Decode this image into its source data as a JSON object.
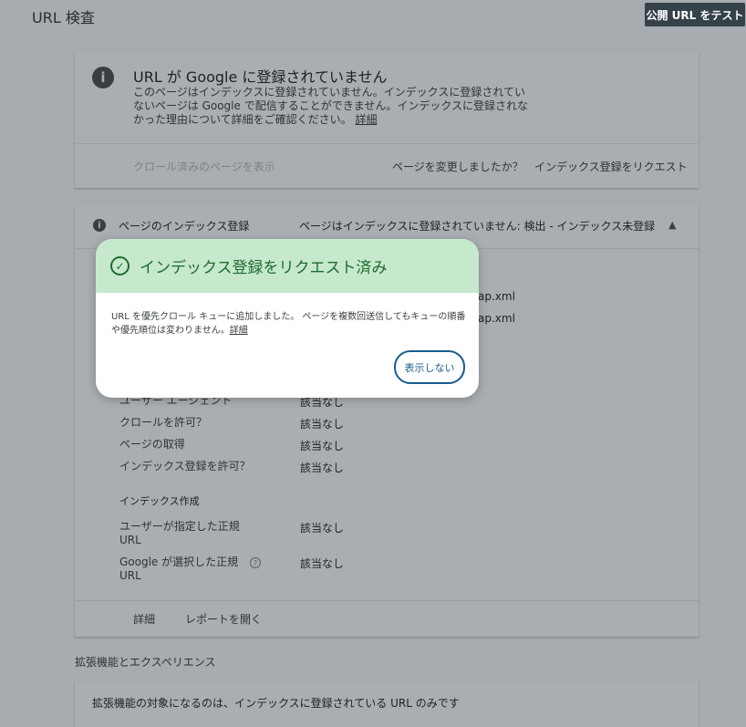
{
  "header": {
    "title": "URL 検査",
    "test_button": "公開 URL をテスト"
  },
  "status_card": {
    "title": "URL が Google に登録されていません",
    "description": "このページはインデックスに登録されていません。インデックスに登録されていないページは Google で配信することができません。インデックスに登録されなかった理由について詳細をご確認ください。",
    "detail_link": "詳細",
    "crawl_link": "クロール済みのページを表示",
    "changed_question": "ページを変更しましたか？",
    "request_link": "インデックス登録をリクエスト"
  },
  "index_card": {
    "title": "ページのインデックス登録",
    "status": "ページはインデックスに登録されていません: 検出 - インデックス未登録",
    "partial_values": [
      "ap.xml",
      "ap.xml"
    ],
    "rows": [
      {
        "label": "ユーザー エージェント",
        "value": "該当なし"
      },
      {
        "label": "クロールを許可？",
        "value": "該当なし"
      },
      {
        "label": "ページの取得",
        "value": "該当なし"
      },
      {
        "label": "インデックス登録を許可？",
        "value": "該当なし"
      }
    ],
    "section_heading": "インデックス作成",
    "canonical_rows": [
      {
        "label": "ユーザーが指定した正規 URL",
        "value": "該当なし"
      },
      {
        "label": "Google が選択した正規 URL",
        "value": "該当なし"
      }
    ],
    "help_symbol": "?",
    "footer_links": [
      "詳細",
      "レポートを開く"
    ]
  },
  "enhancements": {
    "heading": "拡張機能とエクスペリエンス",
    "text": "拡張機能の対象になるのは、インデックスに登録されている URL のみです"
  },
  "dialog": {
    "title": "インデックス登録をリクエスト済み",
    "body": "URL を優先クロール キューに追加しました。 ページを複数回送信してもキューの順番や優先順位は変わりません。",
    "detail_link": "詳細",
    "dismiss_button": "表示しない"
  },
  "icons": {
    "info": "i",
    "check": "✓",
    "chevron": "▲"
  }
}
